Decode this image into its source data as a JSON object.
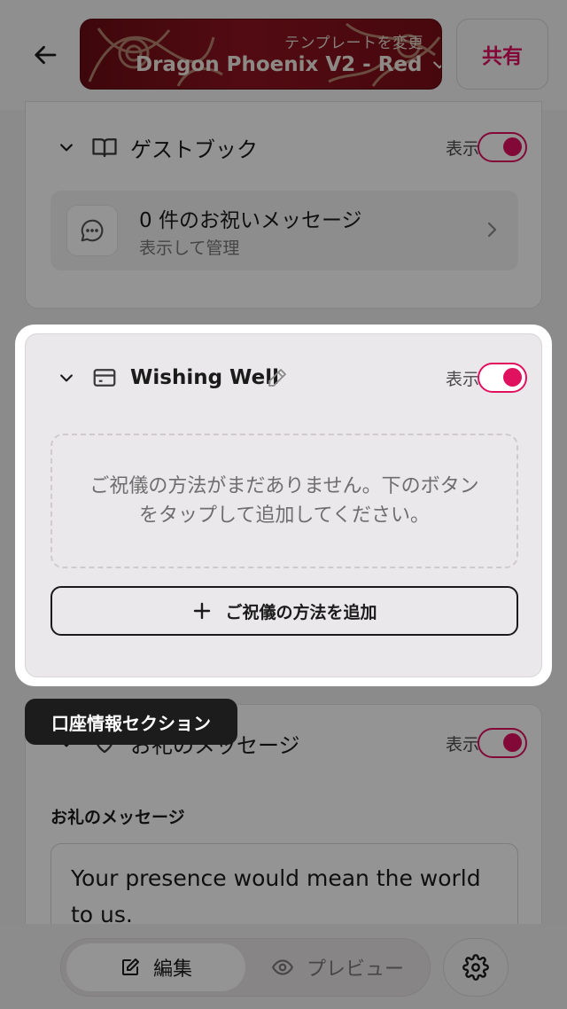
{
  "header": {
    "template_change": "テンプレートを変更",
    "template_name": "Dragon Phoenix V2 - Red",
    "share_label": "共有"
  },
  "guestbook": {
    "title": "ゲストブック",
    "show_label": "表示",
    "visible": true,
    "messages_title": "0 件のお祝いメッセージ",
    "messages_sub": "表示して管理"
  },
  "wishing_well": {
    "title": "Wishing Well",
    "show_label": "表示",
    "visible": true,
    "empty_text": "ご祝儀の方法がまだありません。下のボタンをタップして追加してください。",
    "add_label": "ご祝儀の方法を追加"
  },
  "tooltip": {
    "text": "口座情報セクション"
  },
  "thank_you": {
    "title": "お礼のメッセージ",
    "show_label": "表示",
    "visible": true,
    "field_label": "お礼のメッセージ",
    "message": "Your presence would mean the world to us."
  },
  "bottom_bar": {
    "edit_label": "編集",
    "preview_label": "プレビュー"
  },
  "colors": {
    "accent": "#e0115f",
    "banner": "#8e1420"
  },
  "icons": {
    "back": "arrow-left-icon",
    "dropdown": "chevron-down-icon",
    "guestbook": "book-open-icon",
    "message": "chat-bubble-icon",
    "wishing_well": "card-icon",
    "edit": "pencil-icon",
    "add": "plus-icon",
    "thank_you": "heart-icon",
    "edit_tab": "edit-square-icon",
    "preview_tab": "eye-icon",
    "settings": "gear-icon"
  }
}
